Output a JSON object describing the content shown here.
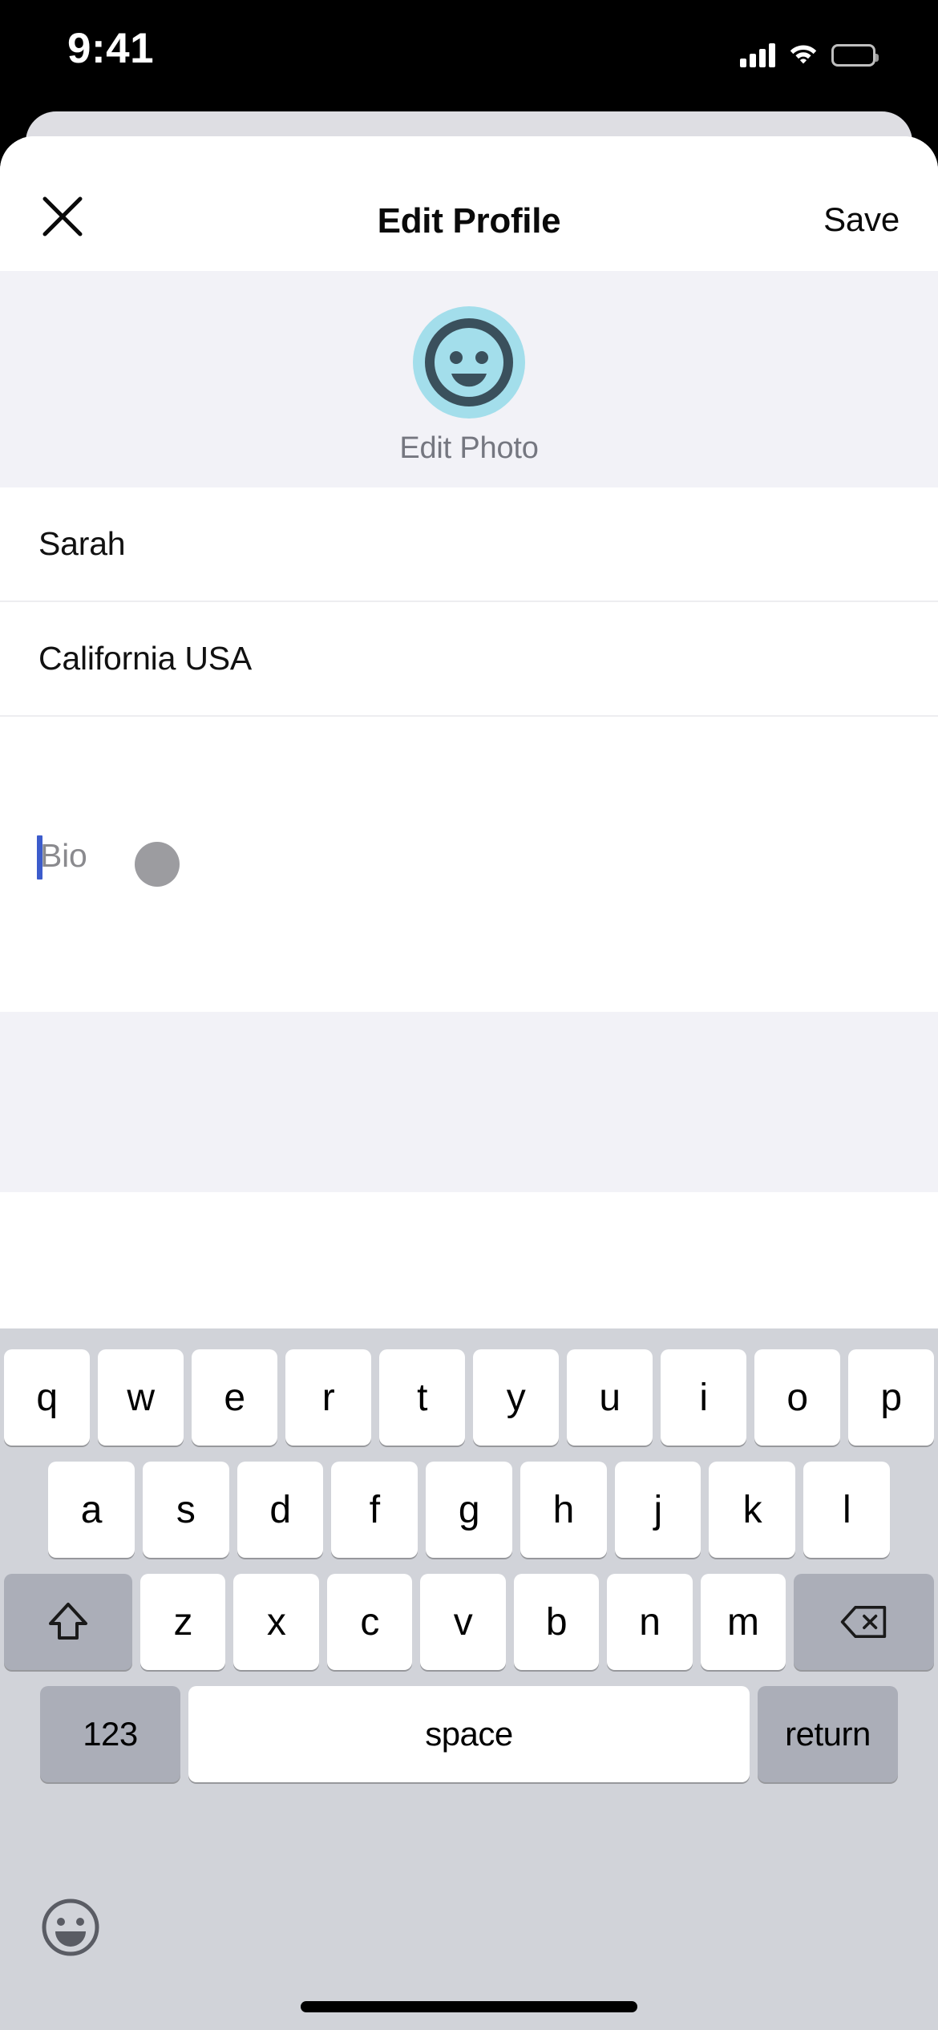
{
  "status_bar": {
    "time": "9:41",
    "signal_icon": "cellular-signal-icon",
    "wifi_icon": "wifi-icon",
    "battery_icon": "battery-icon"
  },
  "nav": {
    "close_icon": "close-x-icon",
    "title": "Edit Profile",
    "save_label": "Save"
  },
  "avatar_section": {
    "avatar_icon": "smiley-avatar-icon",
    "avatar_bg_color": "#A3DEEB",
    "avatar_face_color": "#3A505C",
    "edit_photo_label": "Edit Photo",
    "background_color": "#F2F2F7"
  },
  "form": {
    "fields": [
      {
        "name": "name-field",
        "value": "Sarah",
        "placeholder": "Name"
      },
      {
        "name": "location-field",
        "value": "California USA",
        "placeholder": "Location"
      }
    ],
    "bio": {
      "name": "bio-field",
      "value": "",
      "placeholder": "Bio",
      "caret_color": "#3C5CCC",
      "tap_indicator": "touch-point-indicator"
    }
  },
  "keyboard": {
    "background_color": "#D1D3D9",
    "row1": [
      "q",
      "w",
      "e",
      "r",
      "t",
      "y",
      "u",
      "i",
      "o",
      "p"
    ],
    "row2": [
      "a",
      "s",
      "d",
      "f",
      "g",
      "h",
      "j",
      "k",
      "l"
    ],
    "row3_letters": [
      "z",
      "x",
      "c",
      "v",
      "b",
      "n",
      "m"
    ],
    "shift_icon": "shift-arrow-icon",
    "delete_icon": "backspace-delete-icon",
    "numbers_label": "123",
    "space_label": "space",
    "return_label": "return",
    "emoji_icon": "emoji-smiley-icon"
  },
  "home_indicator": "home-indicator-bar"
}
